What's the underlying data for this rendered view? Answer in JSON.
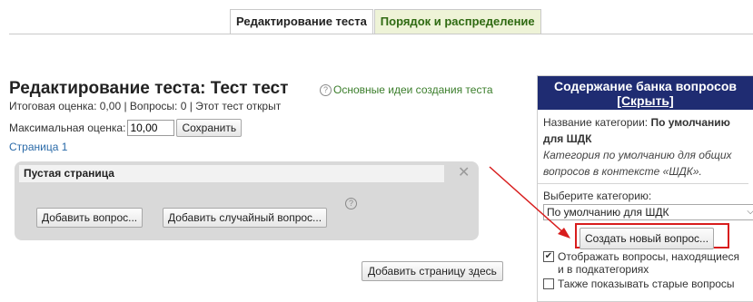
{
  "tabs": [
    {
      "label": "Редактирование теста",
      "active": true
    },
    {
      "label": "Порядок и распределение",
      "active": false
    }
  ],
  "quiz": {
    "title": "Редактирование теста: Тест тест",
    "help_link": "Основные идеи создания теста",
    "info": "Итоговая оценка: 0,00 | Вопросы: 0 | Этот тест открыт",
    "max_grade_label": "Максимальная оценка:",
    "max_grade_value": "10,00",
    "save_label": "Сохранить",
    "page_label": "Страница 1",
    "section_title": "Пустая страница",
    "add_question": "Добавить вопрос...",
    "add_random_question": "Добавить случайный вопрос...",
    "add_page_here": "Добавить страницу здесь"
  },
  "bank": {
    "title": "Содержание банка вопросов",
    "hide_label": "[Скрыть]",
    "category_label": "Название категории:",
    "category_name": "По умолчанию для ШДК",
    "category_desc": "Категория по умолчанию для общих вопросов в контексте «ШДК».",
    "choose_label": "Выберите категорию:",
    "selected_category": "По умолчанию для ШДК",
    "create_question": "Создать новый вопрос...",
    "show_sub_label": "Отображать вопросы, находящиеся и в подкатегориях",
    "show_sub_checked": true,
    "show_old_label": "Также показывать старые вопросы",
    "show_old_checked": false
  },
  "colors": {
    "bank_header": "#1f2c72",
    "highlight_box": "#d81d1d",
    "tab_inactive_bg": "#eef3d7",
    "tab_inactive_text": "#2f6a12",
    "section_bg": "#d9d9d9"
  },
  "icons": {
    "help": "question-circle-icon",
    "close": "close-icon",
    "dropdown": "chevron-down-icon",
    "annotation": "red-arrow"
  }
}
